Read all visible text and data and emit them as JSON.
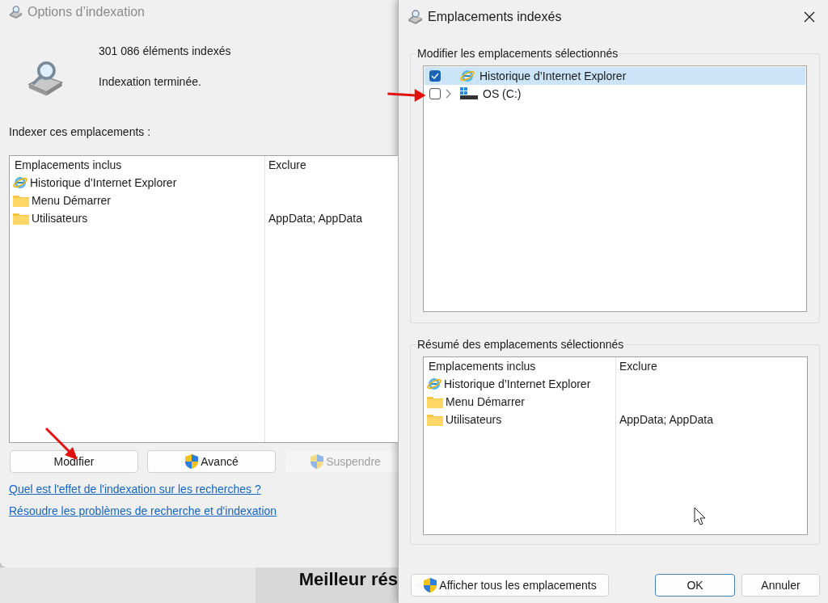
{
  "main_window": {
    "title": "Options d’indexation",
    "stats": [
      "301 086 éléments indexés",
      "Indexation terminée."
    ],
    "locations_label": "Indexer ces emplacements :",
    "table": {
      "columns": [
        "Emplacements inclus",
        "Exclure"
      ],
      "rows": [
        {
          "kind": "ie",
          "name": "Historique d’Internet Explorer",
          "exclude": ""
        },
        {
          "kind": "folder",
          "name": "Menu Démarrer",
          "exclude": ""
        },
        {
          "kind": "folder",
          "name": "Utilisateurs",
          "exclude": "AppData; AppData"
        }
      ]
    },
    "buttons": [
      {
        "label": "Modifier",
        "shield": false,
        "disabled": false
      },
      {
        "label": "Avancé",
        "shield": true,
        "disabled": false
      },
      {
        "label": "Suspendre",
        "shield": true,
        "disabled": true
      }
    ],
    "links": [
      "Quel est l'effet de l'indexation sur les recherches ?",
      "Résoudre les problèmes de recherche et d'indexation"
    ]
  },
  "background_text": "Meilleur rés",
  "dialog": {
    "title": "Emplacements indexés",
    "modify_label": "Modifier les emplacements sélectionnés",
    "tree": [
      {
        "kind": "ie",
        "label": "Historique d’Internet Explorer",
        "checked": true,
        "selected": true,
        "expandable": false
      },
      {
        "kind": "drive",
        "label": "OS (C:)",
        "checked": false,
        "selected": false,
        "expandable": true
      }
    ],
    "summary_label": "Résumé des emplacements sélectionnés",
    "summary": {
      "columns": [
        "Emplacements inclus",
        "Exclure"
      ],
      "rows": [
        {
          "kind": "ie",
          "name": "Historique d’Internet Explorer",
          "exclude": ""
        },
        {
          "kind": "folder",
          "name": "Menu Démarrer",
          "exclude": ""
        },
        {
          "kind": "folder",
          "name": "Utilisateurs",
          "exclude": "AppData; AppData"
        }
      ]
    },
    "buttons": [
      {
        "label": "Afficher tous les emplacements",
        "shield": true,
        "default": false
      },
      {
        "label": "OK",
        "shield": false,
        "default": true
      },
      {
        "label": "Annuler",
        "shield": false,
        "default": false
      }
    ]
  }
}
